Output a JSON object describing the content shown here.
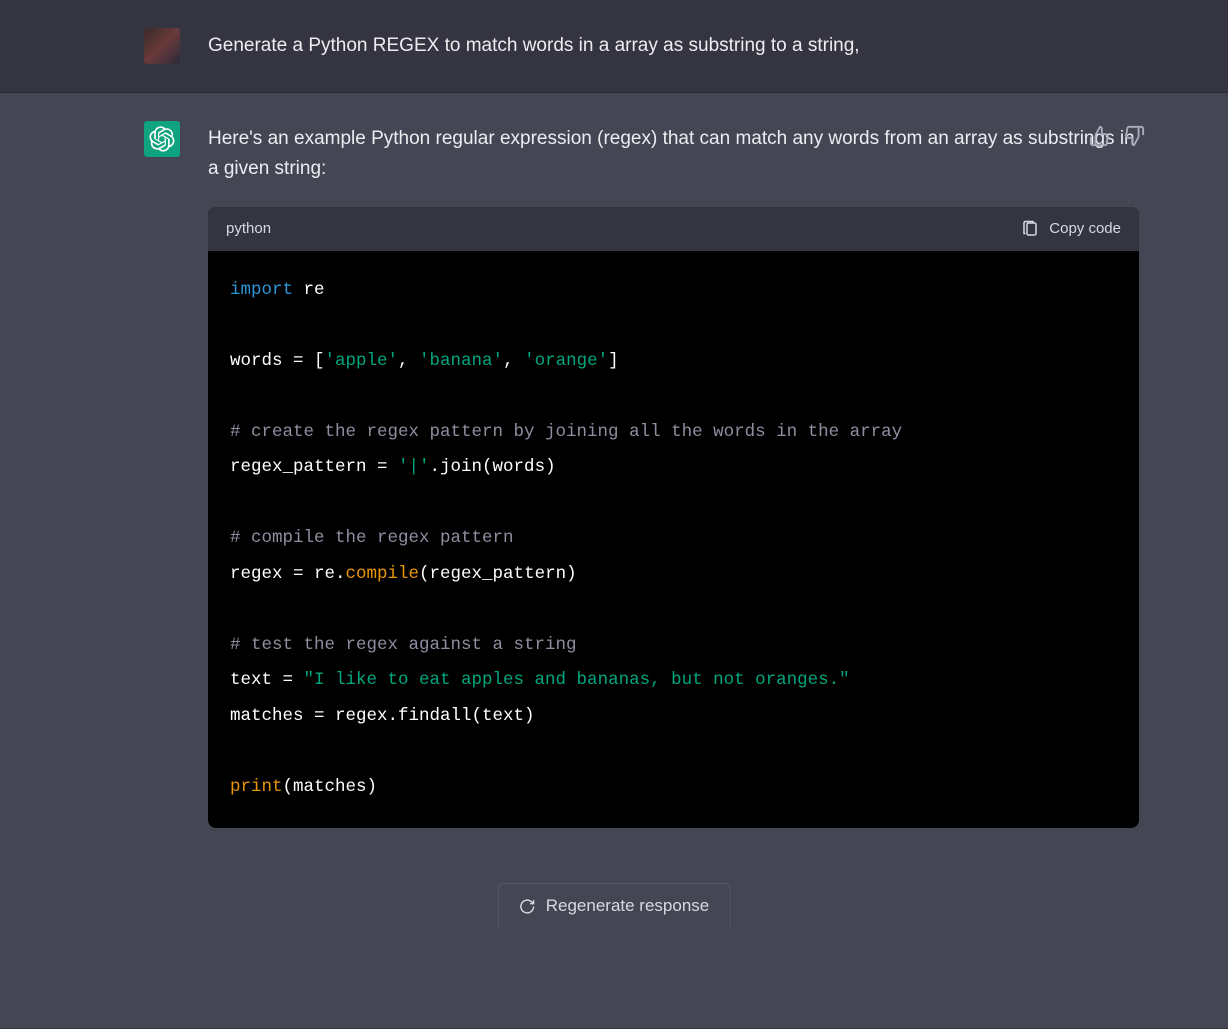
{
  "user": {
    "message": "Generate a Python REGEX to match words in a array as substring to a string,"
  },
  "assistant": {
    "intro": "Here's an example Python regular expression (regex) that can match any words from an array as substrings in a given string:",
    "code": {
      "language": "python",
      "copy_label": "Copy code",
      "tokens": [
        {
          "t": "kw",
          "v": "import"
        },
        {
          "t": "",
          "v": " re\n\nwords = ["
        },
        {
          "t": "str",
          "v": "'apple'"
        },
        {
          "t": "",
          "v": ", "
        },
        {
          "t": "str",
          "v": "'banana'"
        },
        {
          "t": "",
          "v": ", "
        },
        {
          "t": "str",
          "v": "'orange'"
        },
        {
          "t": "",
          "v": "]\n\n"
        },
        {
          "t": "cm",
          "v": "# create the regex pattern by joining all the words in the array"
        },
        {
          "t": "",
          "v": "\nregex_pattern = "
        },
        {
          "t": "str",
          "v": "'|'"
        },
        {
          "t": "",
          "v": ".join(words)\n\n"
        },
        {
          "t": "cm",
          "v": "# compile the regex pattern"
        },
        {
          "t": "",
          "v": "\nregex = re."
        },
        {
          "t": "fn",
          "v": "compile"
        },
        {
          "t": "",
          "v": "(regex_pattern)\n\n"
        },
        {
          "t": "cm",
          "v": "# test the regex against a string"
        },
        {
          "t": "",
          "v": "\ntext = "
        },
        {
          "t": "str",
          "v": "\"I like to eat apples and bananas, but not oranges.\""
        },
        {
          "t": "",
          "v": "\nmatches = regex.findall(text)\n\n"
        },
        {
          "t": "fn",
          "v": "print"
        },
        {
          "t": "",
          "v": "(matches)"
        }
      ]
    }
  },
  "regenerate_label": "Regenerate response"
}
